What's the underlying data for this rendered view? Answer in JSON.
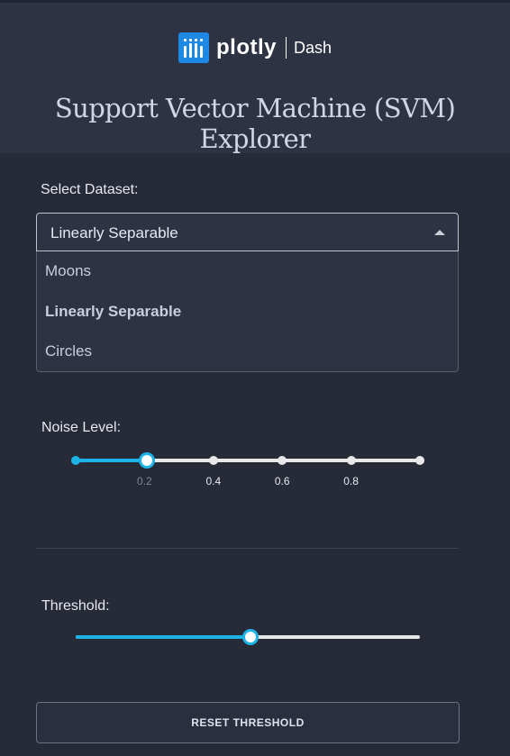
{
  "header": {
    "brand_name": "plotly",
    "brand_sub": "Dash",
    "title": "Support Vector Machine (SVM) Explorer"
  },
  "dataset": {
    "label": "Select Dataset:",
    "selected": "Linearly Separable",
    "options": [
      "Moons",
      "Linearly Separable",
      "Circles"
    ]
  },
  "noise": {
    "label": "Noise Level:",
    "value": 0.2,
    "min": 0,
    "max": 1,
    "marks": [
      "0.2",
      "0.4",
      "0.6",
      "0.8"
    ]
  },
  "threshold": {
    "label": "Threshold:",
    "value_fraction": 0.5
  },
  "reset_button": "RESET THRESHOLD",
  "colors": {
    "accent": "#1eb3e6",
    "brand": "#1e88e5",
    "background": "#272b38",
    "header": "#2e3344"
  }
}
